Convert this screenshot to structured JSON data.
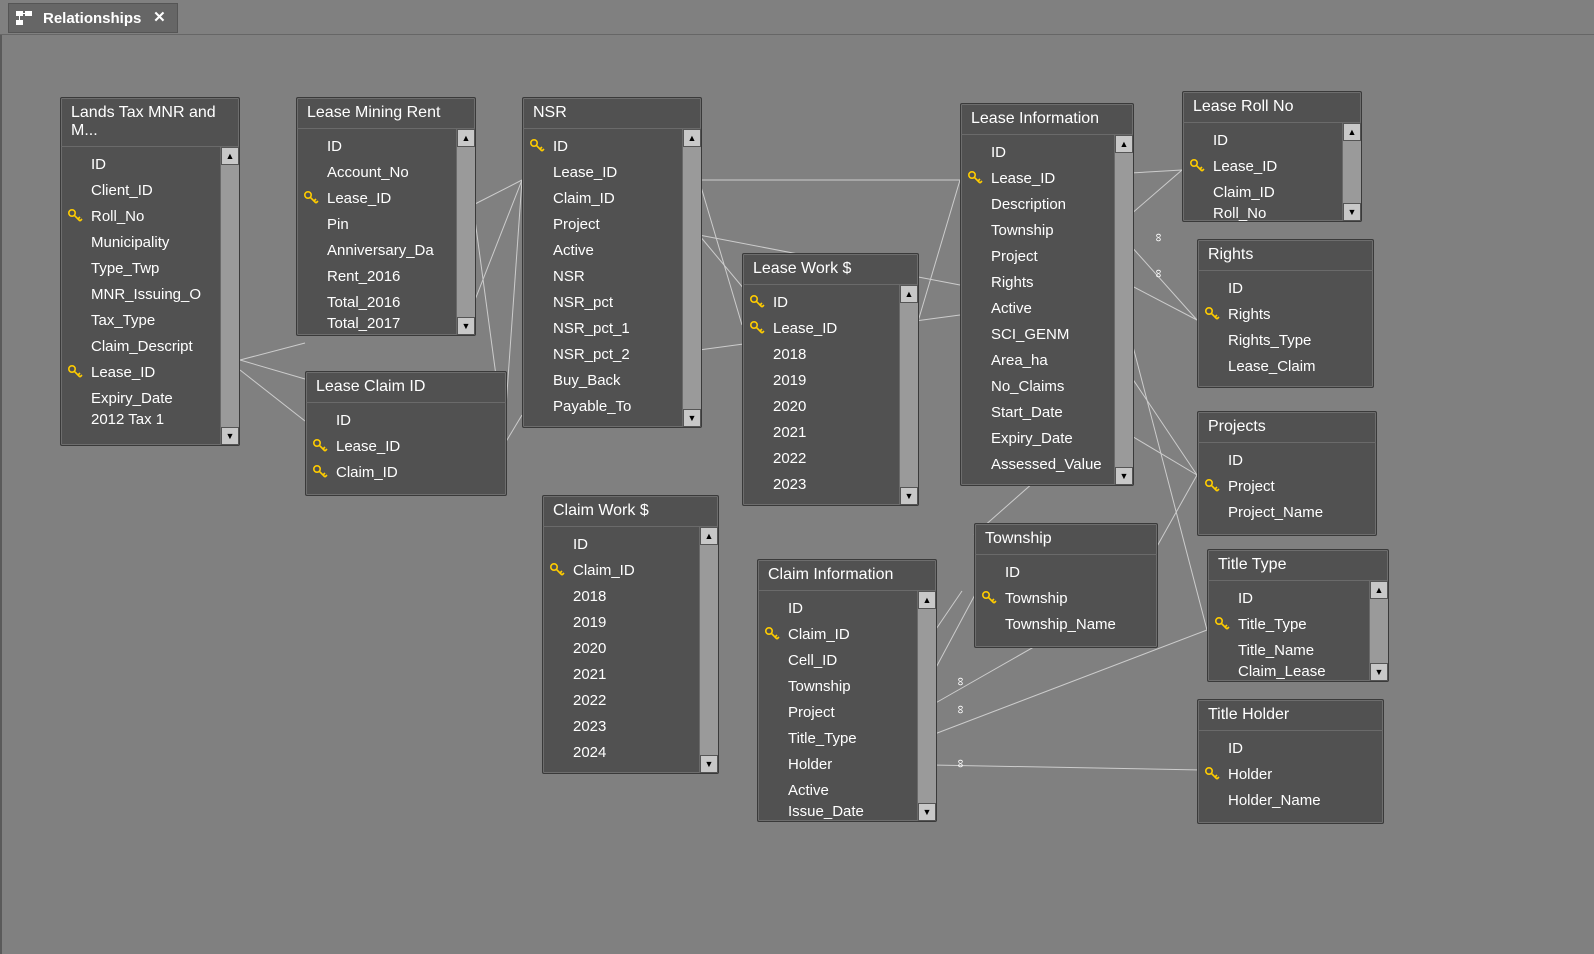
{
  "tab": {
    "title": "Relationships"
  },
  "tables": {
    "lands_tax": {
      "title": "Lands Tax MNR and M...",
      "fields": [
        "ID",
        "Client_ID",
        "Roll_No",
        "Municipality",
        "Type_Twp",
        "MNR_Issuing_O",
        "Tax_Type",
        "Claim_Descript",
        "Lease_ID",
        "Expiry_Date",
        "2012 Tax 1"
      ],
      "keys": [
        2,
        8
      ]
    },
    "lease_mining_rent": {
      "title": "Lease Mining Rent",
      "fields": [
        "ID",
        "Account_No",
        "Lease_ID",
        "Pin",
        "Anniversary_Da",
        "Rent_2016",
        "Total_2016",
        "Total_2017"
      ],
      "keys": [
        2
      ]
    },
    "lease_claim_id": {
      "title": "Lease Claim ID",
      "fields": [
        "ID",
        "Lease_ID",
        "Claim_ID"
      ],
      "keys": [
        1,
        2
      ]
    },
    "nsr": {
      "title": "NSR",
      "fields": [
        "ID",
        "Lease_ID",
        "Claim_ID",
        "Project",
        "Active",
        "NSR",
        "NSR_pct",
        "NSR_pct_1",
        "NSR_pct_2",
        "Buy_Back",
        "Payable_To"
      ],
      "keys": [
        0
      ]
    },
    "lease_work": {
      "title": "Lease Work $",
      "fields": [
        "ID",
        "Lease_ID",
        "2018",
        "2019",
        "2020",
        "2021",
        "2022",
        "2023"
      ],
      "keys": [
        0,
        1
      ]
    },
    "claim_work": {
      "title": "Claim Work $",
      "fields": [
        "ID",
        "Claim_ID",
        "2018",
        "2019",
        "2020",
        "2021",
        "2022",
        "2023",
        "2024"
      ],
      "keys": [
        1
      ]
    },
    "claim_info": {
      "title": "Claim Information",
      "fields": [
        "ID",
        "Claim_ID",
        "Cell_ID",
        "Township",
        "Project",
        "Title_Type",
        "Holder",
        "Active",
        "Issue_Date"
      ],
      "keys": [
        1
      ]
    },
    "lease_info": {
      "title": "Lease Information",
      "fields": [
        "ID",
        "Lease_ID",
        "Description",
        "Township",
        "Project",
        "Rights",
        "Active",
        "SCI_GENM",
        "Area_ha",
        "No_Claims",
        "Start_Date",
        "Expiry_Date",
        "Assessed_Value"
      ],
      "keys": [
        1
      ]
    },
    "lease_roll_no": {
      "title": "Lease Roll No",
      "fields": [
        "ID",
        "Lease_ID",
        "Claim_ID",
        "Roll_No"
      ],
      "keys": [
        1
      ]
    },
    "rights": {
      "title": "Rights",
      "fields": [
        "ID",
        "Rights",
        "Rights_Type",
        "Lease_Claim"
      ],
      "keys": [
        1
      ]
    },
    "projects": {
      "title": "Projects",
      "fields": [
        "ID",
        "Project",
        "Project_Name"
      ],
      "keys": [
        1
      ]
    },
    "township": {
      "title": "Township",
      "fields": [
        "ID",
        "Township",
        "Township_Name"
      ],
      "keys": [
        1
      ]
    },
    "title_type": {
      "title": "Title Type",
      "fields": [
        "ID",
        "Title_Type",
        "Title_Name",
        "Claim_Lease"
      ],
      "keys": [
        1
      ]
    },
    "title_holder": {
      "title": "Title Holder",
      "fields": [
        "ID",
        "Holder",
        "Holder_Name"
      ],
      "keys": [
        1
      ]
    }
  }
}
